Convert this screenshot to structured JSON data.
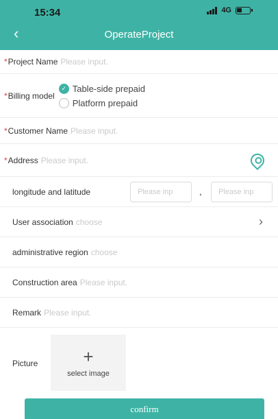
{
  "status_bar": {
    "time": "15:34",
    "network": "4G"
  },
  "header": {
    "title": "OperateProject"
  },
  "form": {
    "project_name": {
      "label": "Project Name",
      "placeholder": "Please input."
    },
    "billing_model": {
      "label": "Billing model",
      "options": [
        "Table-side prepaid",
        "Platform prepaid"
      ],
      "selected": "Table-side prepaid"
    },
    "customer_name": {
      "label": "Customer Name",
      "placeholder": "Please input."
    },
    "address": {
      "label": "Address",
      "placeholder": "Please input."
    },
    "longitude_latitude": {
      "label": "longitude and latitude",
      "placeholder_1": "Please inp",
      "separator": ",",
      "placeholder_2": "Please inp"
    },
    "user_association": {
      "label": "User association",
      "placeholder": "choose"
    },
    "administrative_region": {
      "label": "administrative region",
      "placeholder": "choose"
    },
    "construction_area": {
      "label": "Construction area",
      "placeholder": "Please input."
    },
    "remark": {
      "label": "Remark",
      "placeholder": "Please input."
    },
    "picture": {
      "label": "Picture",
      "upload_text": "select image"
    }
  },
  "confirm_label": "confirm",
  "theme": {
    "accent": "#3eb3a5",
    "required": "#e03a3a"
  }
}
